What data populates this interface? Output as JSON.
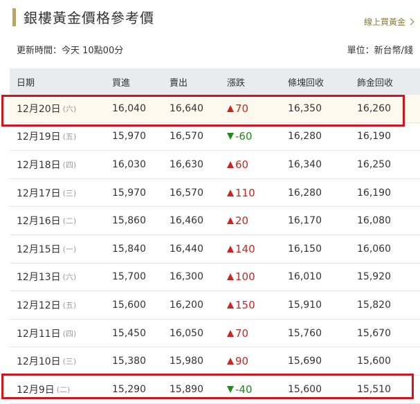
{
  "header": {
    "title": "銀樓黃金價格參考價",
    "online_link": "線上買黃金"
  },
  "meta": {
    "updated": "更新時間：今天 10點00分",
    "unit": "單位：新台幣/錢"
  },
  "table": {
    "columns": [
      "日期",
      "買進",
      "賣出",
      "漲跌",
      "條塊回收",
      "飾金回收"
    ],
    "rows": [
      {
        "date": "12月20日",
        "weekday": "(六)",
        "buy": "16,040",
        "sell": "16,640",
        "change": "70",
        "direction": "up",
        "bar": "16,350",
        "jewel": "16,260",
        "highlighted": true
      },
      {
        "date": "12月19日",
        "weekday": "(五)",
        "buy": "15,970",
        "sell": "16,570",
        "change": "-60",
        "direction": "down",
        "bar": "16,280",
        "jewel": "16,190",
        "highlighted": false
      },
      {
        "date": "12月18日",
        "weekday": "(四)",
        "buy": "16,030",
        "sell": "16,630",
        "change": "60",
        "direction": "up",
        "bar": "16,340",
        "jewel": "16,250",
        "highlighted": false
      },
      {
        "date": "12月17日",
        "weekday": "(三)",
        "buy": "15,970",
        "sell": "16,570",
        "change": "110",
        "direction": "up",
        "bar": "16,280",
        "jewel": "16,190",
        "highlighted": false
      },
      {
        "date": "12月16日",
        "weekday": "(二)",
        "buy": "15,860",
        "sell": "16,460",
        "change": "20",
        "direction": "up",
        "bar": "16,170",
        "jewel": "16,080",
        "highlighted": false
      },
      {
        "date": "12月15日",
        "weekday": "(一)",
        "buy": "15,840",
        "sell": "16,440",
        "change": "140",
        "direction": "up",
        "bar": "16,150",
        "jewel": "16,060",
        "highlighted": false
      },
      {
        "date": "12月13日",
        "weekday": "(六)",
        "buy": "15,700",
        "sell": "16,300",
        "change": "100",
        "direction": "up",
        "bar": "16,010",
        "jewel": "15,920",
        "highlighted": false
      },
      {
        "date": "12月12日",
        "weekday": "(五)",
        "buy": "15,600",
        "sell": "16,200",
        "change": "150",
        "direction": "up",
        "bar": "15,910",
        "jewel": "15,820",
        "highlighted": false
      },
      {
        "date": "12月11日",
        "weekday": "(四)",
        "buy": "15,450",
        "sell": "16,050",
        "change": "70",
        "direction": "up",
        "bar": "15,760",
        "jewel": "15,670",
        "highlighted": false
      },
      {
        "date": "12月10日",
        "weekday": "(三)",
        "buy": "15,380",
        "sell": "15,980",
        "change": "90",
        "direction": "up",
        "bar": "15,690",
        "jewel": "15,600",
        "highlighted": false
      },
      {
        "date": "12月9日",
        "weekday": "(二)",
        "buy": "15,290",
        "sell": "15,890",
        "change": "-40",
        "direction": "down",
        "bar": "15,600",
        "jewel": "15,510",
        "highlighted": false
      }
    ]
  },
  "colors": {
    "accent_gold": "#b9a46a",
    "up_red": "#d0231f",
    "down_green": "#1f8a1f",
    "annotation_red": "#d4141c"
  },
  "icons": {
    "link_chevron": "chevron-right-icon",
    "up": "triangle-up-icon",
    "down": "triangle-down-icon"
  }
}
